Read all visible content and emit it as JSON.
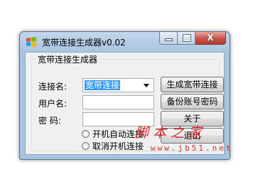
{
  "window": {
    "title": "宽带连接生成器v0.02",
    "close_glyph": "X"
  },
  "group": {
    "title": "宽带连接生成器"
  },
  "form": {
    "connection_label": "连接名:",
    "connection_value": "宽带连接",
    "username_label": "用户名:",
    "password_label": "密    码:",
    "username_value": "",
    "password_value": ""
  },
  "buttons": {
    "generate": "生成宽带连接",
    "backup": "备份账号密码",
    "about": "关于",
    "exit": "退出"
  },
  "options": {
    "autostart": "开机自动连接",
    "cancel_autostart": "取消开机连接"
  },
  "watermark": {
    "title": "脚本之家",
    "url": "www.jb51.net"
  },
  "colors": {
    "selection": "#3399ff",
    "watermark": "#d62b2b",
    "close_button": "#c75050"
  }
}
